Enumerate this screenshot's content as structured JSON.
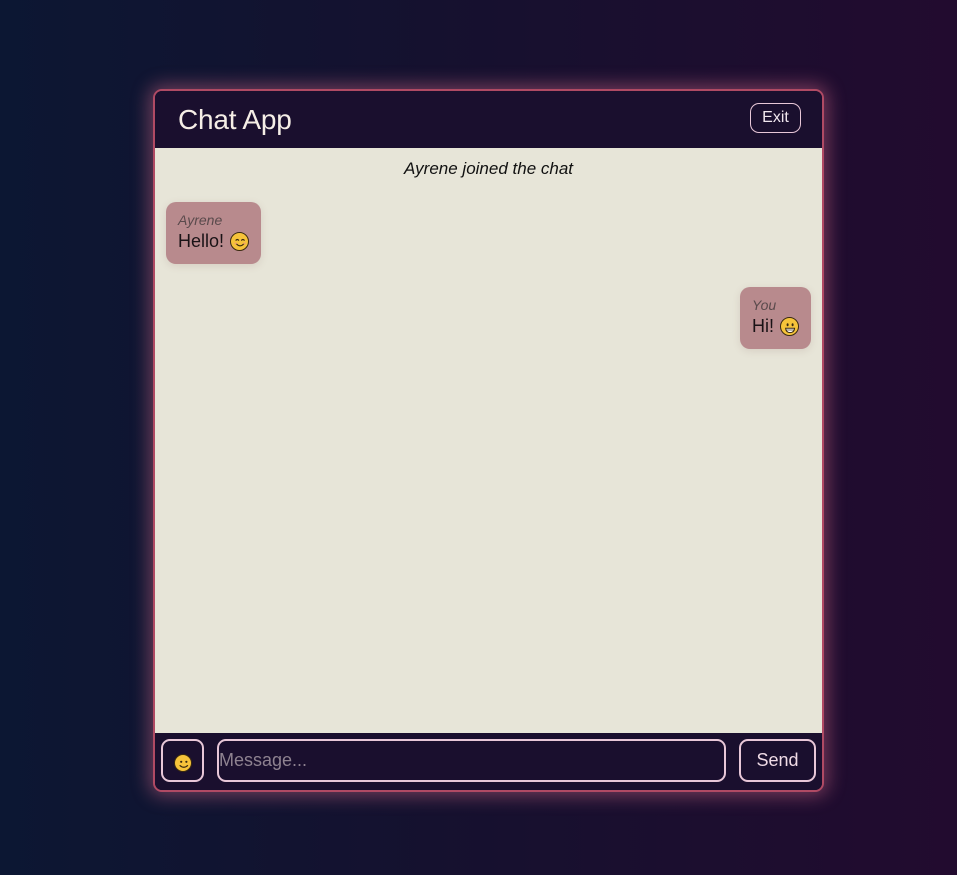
{
  "header": {
    "title": "Chat App",
    "exit_label": "Exit"
  },
  "messages": {
    "system": "Ayrene joined the chat",
    "items": [
      {
        "sender": "Ayrene",
        "text": "Hello!",
        "emoji": "smiling-face-icon",
        "side": "left"
      },
      {
        "sender": "You",
        "text": "Hi!",
        "emoji": "grinning-face-icon",
        "side": "right"
      }
    ]
  },
  "composer": {
    "emoji_icon": "smiley-icon",
    "placeholder": "Message...",
    "value": "",
    "send_label": "Send"
  },
  "colors": {
    "accent": "#e8c7d8",
    "bubble": "#b88a8d",
    "chat_background": "#e7e5d8",
    "frame": "#1a0f2e"
  }
}
